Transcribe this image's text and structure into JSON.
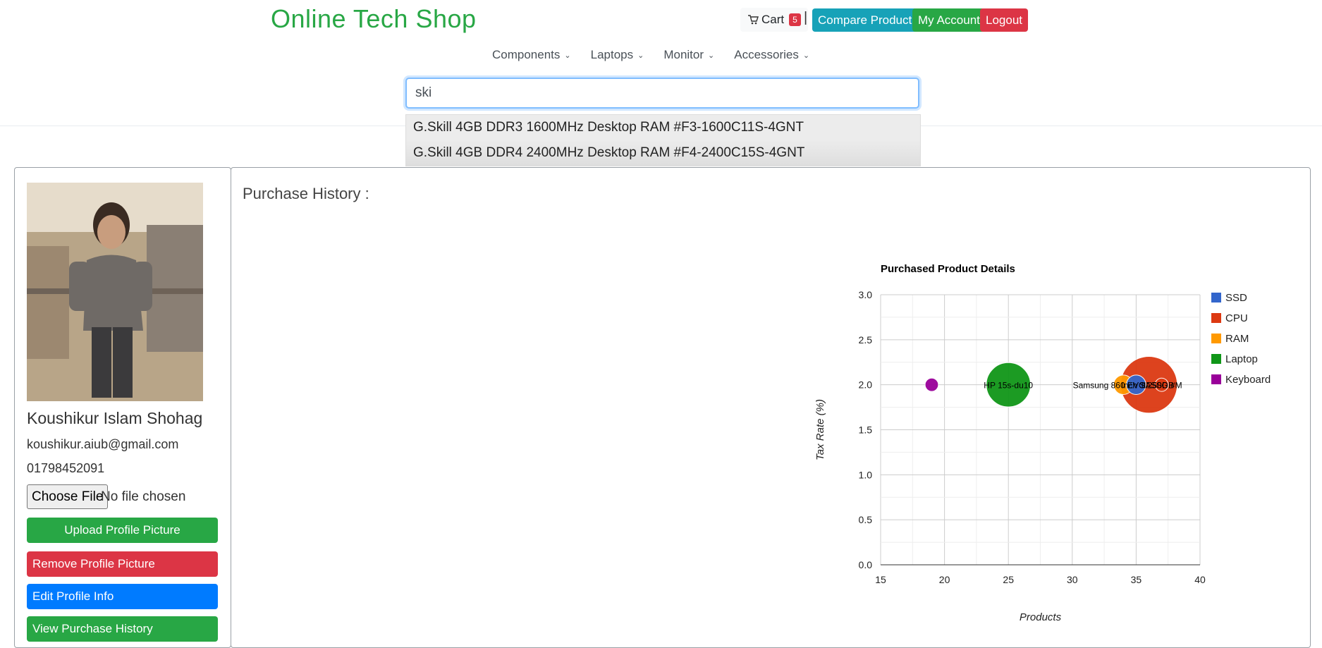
{
  "header": {
    "site_title": "Online Tech Shop",
    "cart_label": "Cart",
    "cart_count": "5",
    "separator": "|",
    "compare_label": "Compare Products",
    "account_label": "My Account",
    "logout_label": "Logout"
  },
  "nav": {
    "items": [
      {
        "label": "Components"
      },
      {
        "label": "Laptops"
      },
      {
        "label": "Monitor"
      },
      {
        "label": "Accessories"
      }
    ]
  },
  "search": {
    "value": "ski",
    "suggestions": [
      "G.Skill 4GB DDR3 1600MHz Desktop RAM #F3-1600C11S-4GNT",
      "G.Skill 4GB DDR4 2400MHz Desktop RAM #F4-2400C15S-4GNT"
    ]
  },
  "profile": {
    "name": "Koushikur Islam Shohag",
    "email": "koushikur.aiub@gmail.com",
    "phone": "01798452091",
    "choose_file_label": "Choose File",
    "file_status": "No file chosen",
    "upload_label": "Upload Profile Picture",
    "remove_label": "Remove Profile Picture",
    "edit_label": "Edit Profile Info",
    "view_history_label": "View Purchase History"
  },
  "purchase_history": {
    "title": "Purchase History :"
  },
  "colors": {
    "SSD": "#3366cc",
    "CPU": "#dc3912",
    "RAM": "#ff9900",
    "Laptop": "#109618",
    "Keyboard": "#990099"
  },
  "chart_data": {
    "type": "scatter",
    "title": "Purchased Product Details",
    "xlabel": "Products",
    "ylabel": "Tax Rate (%)",
    "xlim": [
      15,
      40
    ],
    "ylim": [
      0,
      3
    ],
    "x_ticks": [
      "15",
      "20",
      "25",
      "30",
      "35",
      "40"
    ],
    "y_ticks": [
      "0.0",
      "0.5",
      "1.0",
      "1.5",
      "2.0",
      "2.5",
      "3.0"
    ],
    "grid": true,
    "legend_position": "right",
    "legend": [
      "SSD",
      "CPU",
      "RAM",
      "Laptop",
      "Keyboard"
    ],
    "points": [
      {
        "series": "Keyboard",
        "x": 19,
        "y": 2.0,
        "size": 1,
        "label": ""
      },
      {
        "series": "Laptop",
        "x": 25,
        "y": 2.0,
        "size": 6,
        "label": "HP 15s-du10"
      },
      {
        "series": "RAM",
        "x": 34,
        "y": 2.0,
        "size": 2,
        "label": "Samsung 860 EVO 250GB"
      },
      {
        "series": "SSD",
        "x": 35,
        "y": 2.0,
        "size": 2,
        "label": "Inch SA"
      },
      {
        "series": "CPU",
        "x": 36,
        "y": 2.0,
        "size": 8,
        "label": ""
      },
      {
        "series": "CPU",
        "x": 37,
        "y": 2.0,
        "size": 1,
        "label": "III SSD #M"
      }
    ]
  }
}
